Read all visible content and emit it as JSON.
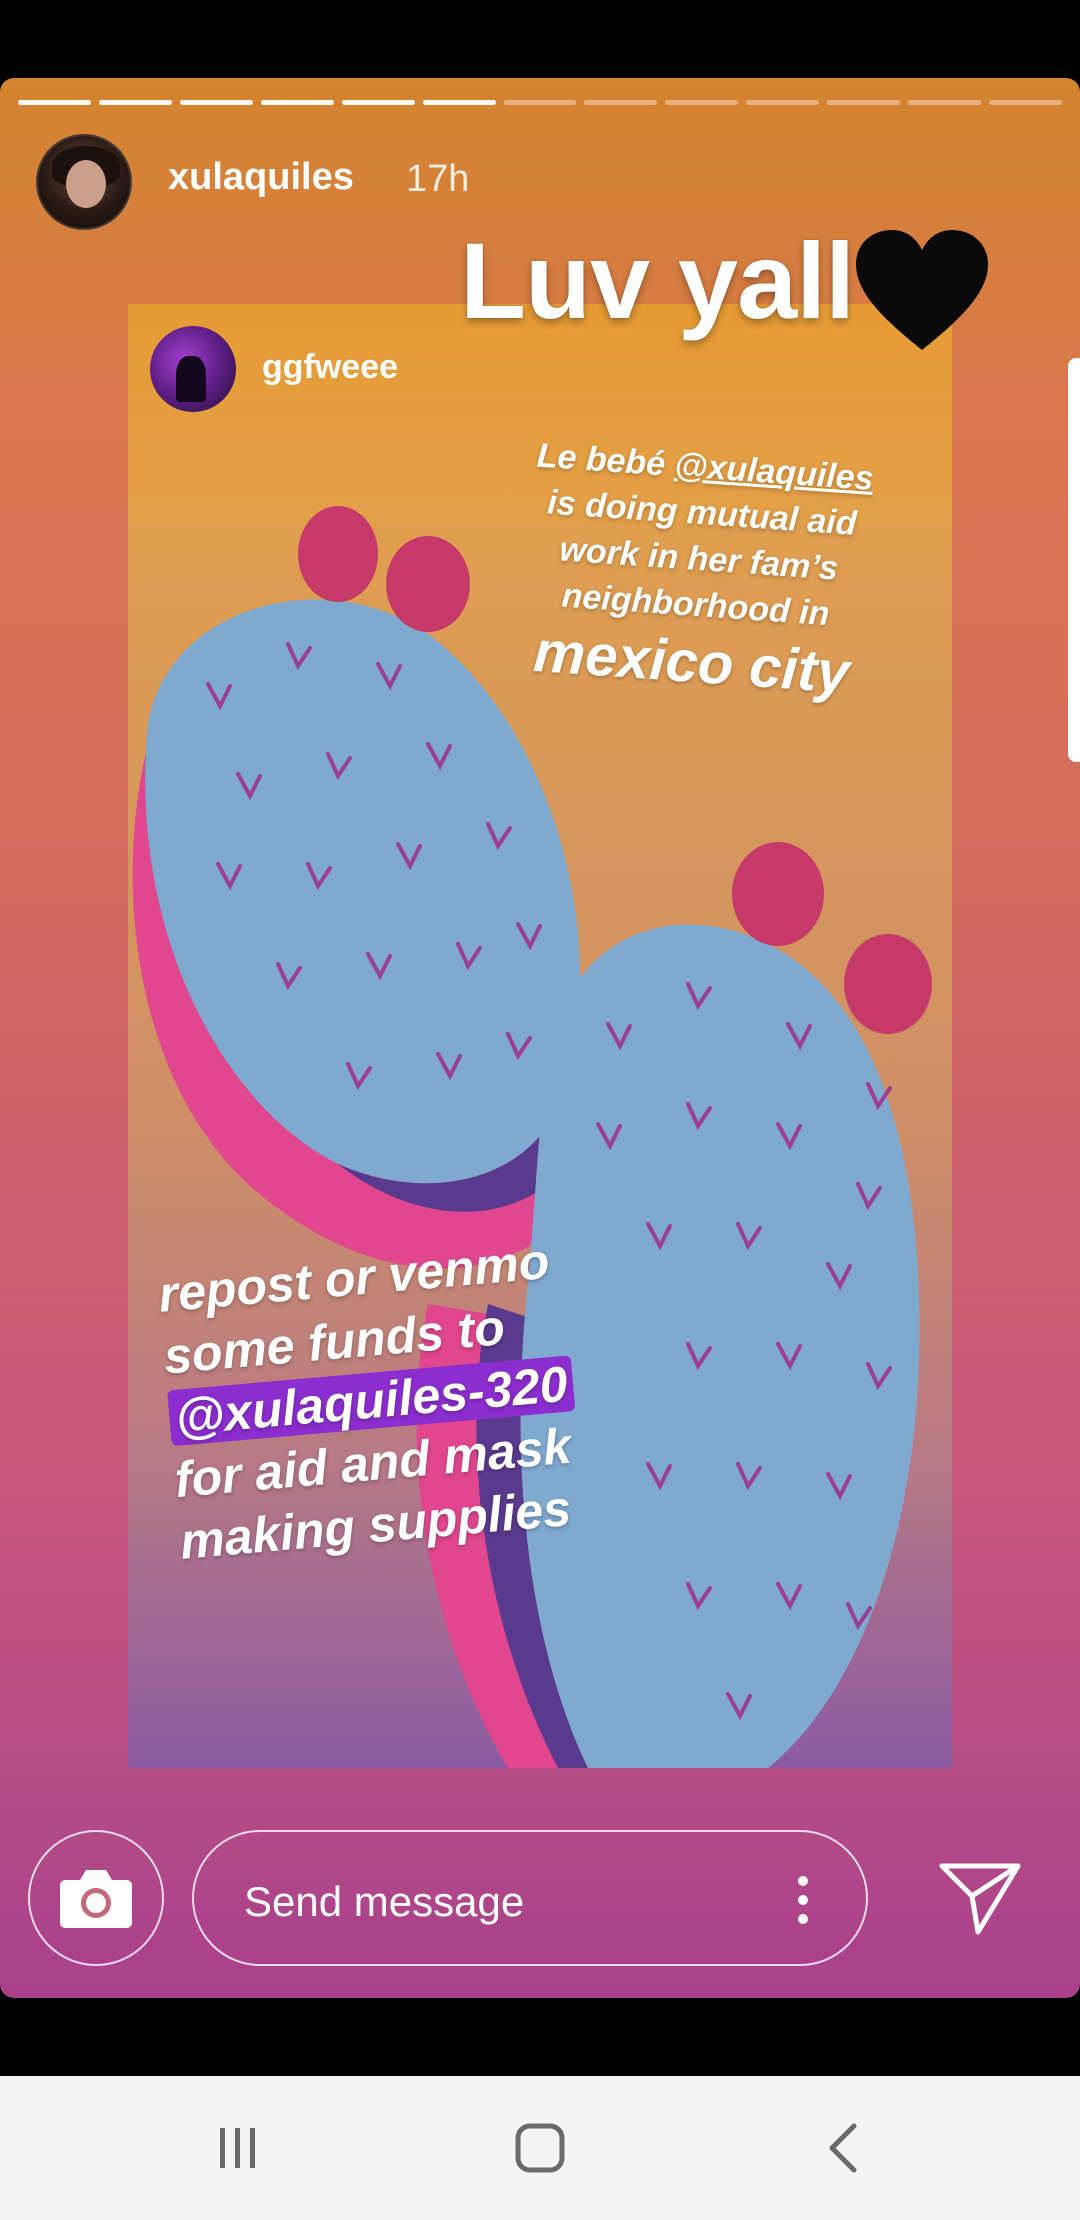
{
  "story": {
    "progress": {
      "total_segments": 13,
      "completed_segments": 6
    },
    "author": {
      "username": "xulaquiles",
      "time_ago": "17h"
    },
    "sticker_text": "Luv yall",
    "sticker_emoji": "black-heart-icon",
    "embedded_post": {
      "username": "ggfweee",
      "text_top": {
        "prefix": "Le bebé ",
        "mention": "@xulaquiles",
        "line2": "is doing mutual aid",
        "line3": "work in her fam’s",
        "line4": "neighborhood in",
        "line5": "mexico city"
      },
      "text_bottom": {
        "line1": "repost or venmo",
        "line2": "some funds to",
        "line3": "@xulaquiles-320",
        "line4": "for aid and mask",
        "line5": "making supplies"
      }
    }
  },
  "reply_bar": {
    "placeholder": "Send message",
    "camera_icon": "camera-icon",
    "more_icon": "more-vertical-icon",
    "send_icon": "send-icon"
  },
  "system_nav": {
    "recents_icon": "recents-icon",
    "home_icon": "home-icon",
    "back_icon": "back-icon"
  },
  "colors": {
    "gradient_top": "#d4852e",
    "gradient_bottom": "#a8408c",
    "cactus": "#7fa9cf",
    "mention_highlight": "#8c2ecf"
  }
}
